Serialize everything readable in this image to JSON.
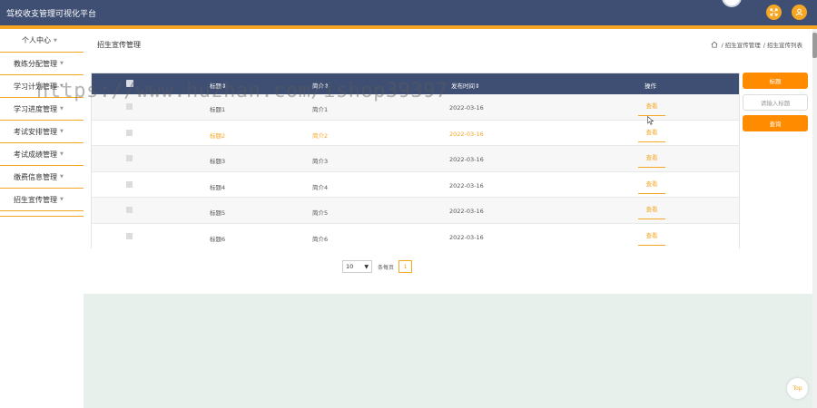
{
  "app": {
    "title": "驾校收支管理可视化平台"
  },
  "sidebar": {
    "items": [
      {
        "label": "个人中心"
      },
      {
        "label": "教练分配管理"
      },
      {
        "label": "学习计划管理"
      },
      {
        "label": "学习进度管理"
      },
      {
        "label": "考试安排管理"
      },
      {
        "label": "考试成绩管理"
      },
      {
        "label": "缴费信息管理"
      },
      {
        "label": "招生宣传管理"
      }
    ]
  },
  "page": {
    "title": "招生宣传管理"
  },
  "breadcrumb": {
    "parts": [
      "/ 招生宣传管理",
      "/ 招生宣传列表"
    ]
  },
  "table": {
    "columns": [
      "标题",
      "简介",
      "发布时间",
      "操作"
    ],
    "sort_mark": "⇕",
    "rows": [
      {
        "title": "标题1",
        "intro": "简介1",
        "date": "2022-03-16",
        "action": "查看"
      },
      {
        "title": "标题2",
        "intro": "简介2",
        "date": "2022-03-16",
        "action": "查看"
      },
      {
        "title": "标题3",
        "intro": "简介3",
        "date": "2022-03-16",
        "action": "查看"
      },
      {
        "title": "标题4",
        "intro": "简介4",
        "date": "2022-03-16",
        "action": "查看"
      },
      {
        "title": "标题5",
        "intro": "简介5",
        "date": "2022-03-16",
        "action": "查看"
      },
      {
        "title": "标题6",
        "intro": "简介6",
        "date": "2022-03-16",
        "action": "查看"
      }
    ]
  },
  "search": {
    "title_button": "标题",
    "title_placeholder": "请输入标题",
    "search_button": "查询"
  },
  "pagination": {
    "page_size": "10",
    "per_page_label": "条每页",
    "current_page": "1"
  },
  "footer": {
    "top_label": "Top"
  },
  "watermark": {
    "text": "https://www.huzhan.com/ishop39397"
  },
  "colors": {
    "header": "#3f4f73",
    "accent": "#f5a623",
    "button": "#ff8c00",
    "bottom": "#e8f0ec"
  }
}
